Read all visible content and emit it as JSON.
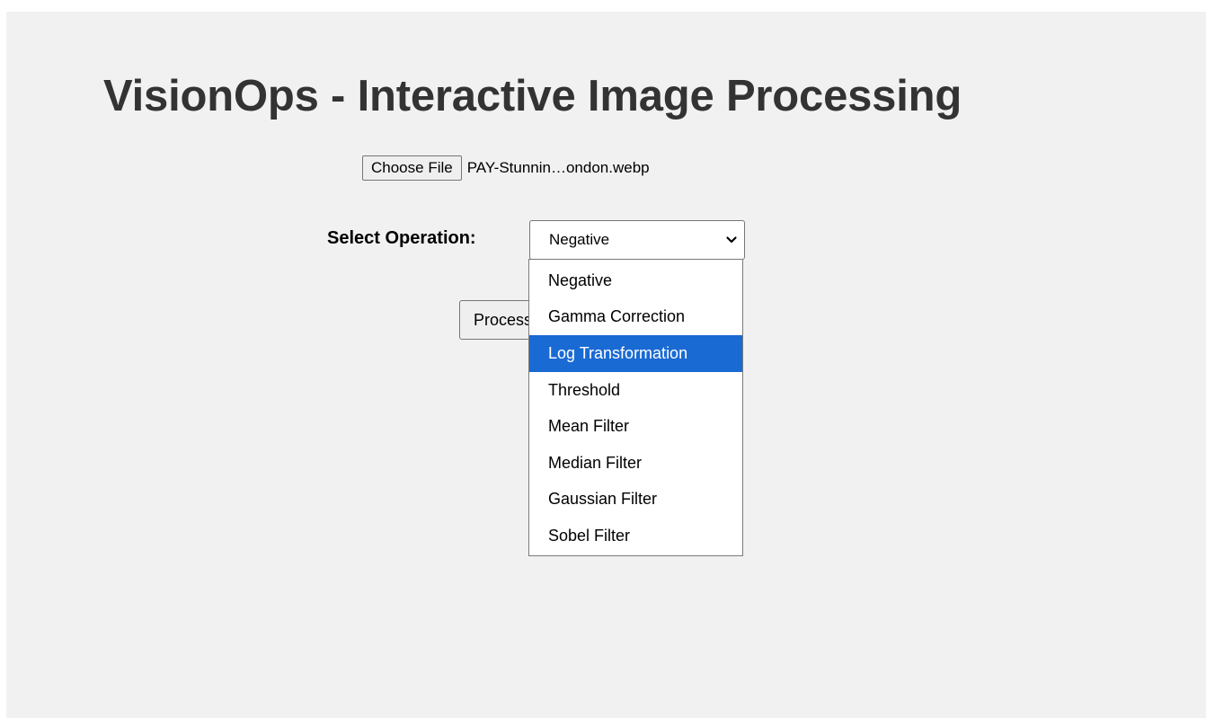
{
  "page": {
    "title": "VisionOps - Interactive Image Processing"
  },
  "file_input": {
    "button_label": "Choose File",
    "file_name": "PAY-Stunnin…ondon.webp"
  },
  "operation": {
    "label": "Select Operation:",
    "selected_value": "Negative",
    "highlighted_option": "Log Transformation",
    "options": [
      "Negative",
      "Gamma Correction",
      "Log Transformation",
      "Threshold",
      "Mean Filter",
      "Median Filter",
      "Gaussian Filter",
      "Sobel Filter"
    ]
  },
  "process_button": {
    "label": "Process"
  },
  "colors": {
    "page_background": "#f1f1f1",
    "title_text": "#333333",
    "highlight": "#1a6ad4"
  },
  "icons": {
    "select_arrow": "chevron-down-icon"
  }
}
